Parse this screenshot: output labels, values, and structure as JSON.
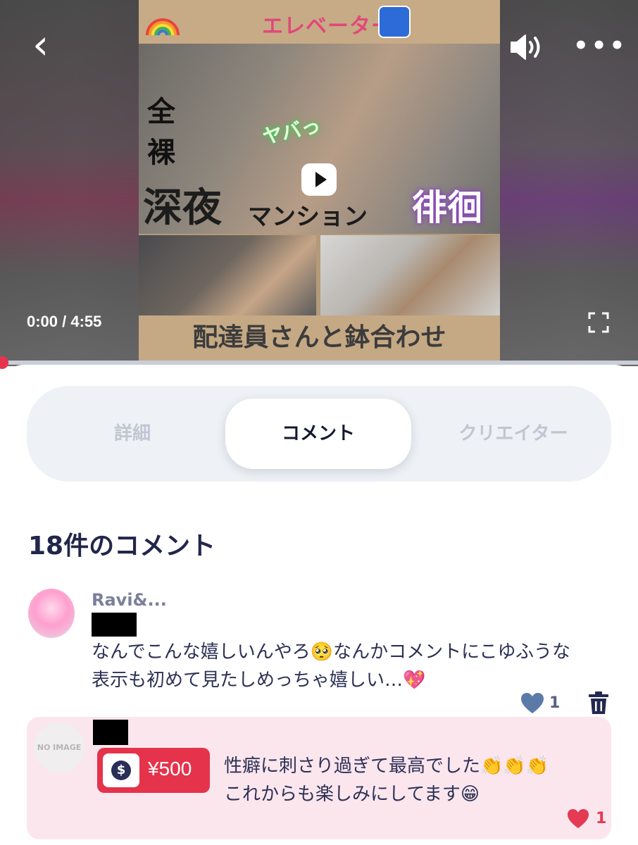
{
  "video": {
    "time_display": "0:00 / 4:55",
    "progress_fraction": 0.0,
    "thumbnail_text": {
      "banner": "エレベーター",
      "vertical": "全裸",
      "line_left": "深夜",
      "line_middle": "マンション",
      "line_right": "徘徊",
      "exclaim": "ヤバっ",
      "bottom": "配達員さんと鉢合わせ"
    },
    "icons": [
      "back-icon",
      "sound-icon",
      "more-icon",
      "play-icon",
      "fullscreen-icon"
    ]
  },
  "tabs": [
    {
      "label": "詳細",
      "active": false
    },
    {
      "label": "コメント",
      "active": true
    },
    {
      "label": "クリエイター",
      "active": false
    }
  ],
  "comments_header": "18件のコメント",
  "comments": [
    {
      "user": "Ravi&...",
      "text_line1": "なんでこんな嬉しいんやろ🥺なんかコメントにこゆふうな",
      "text_line2": "表示も初めて見たしめっちゃ嬉しい…💖",
      "likes": "1"
    },
    {
      "avatar_label": "NO IMAGE",
      "tip_amount": "¥500",
      "text_line1": "性癖に刺さり過ぎて最高でした👏👏👏",
      "text_line2": "これからも楽しみにしてます😁",
      "likes": "1"
    }
  ],
  "colors": {
    "accent_red": "#e5334b",
    "tip_row_bg": "#fbe6ee",
    "heading": "#22264a",
    "tab_inactive": "#c0c6d2"
  }
}
